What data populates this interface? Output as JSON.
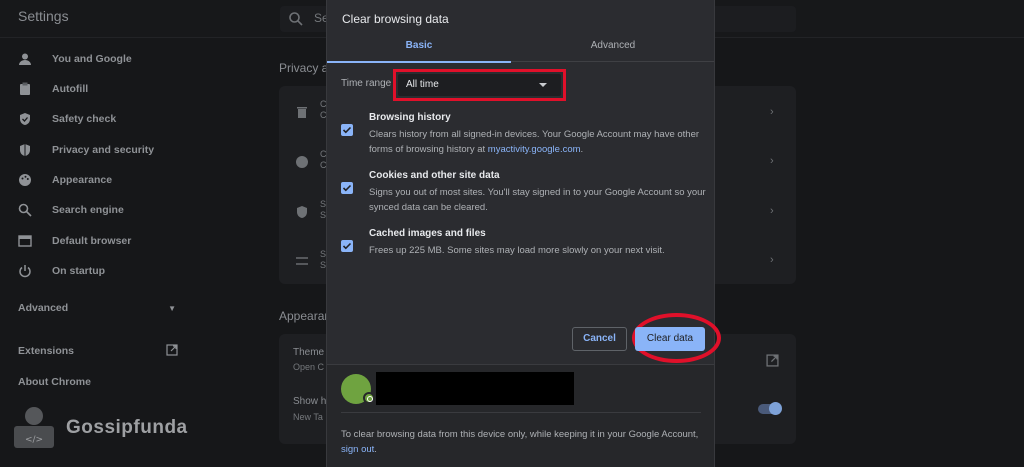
{
  "app": {
    "title": "Settings",
    "search_placeholder": "Se"
  },
  "sidebar": {
    "items": [
      {
        "label": "You and Google",
        "icon": "person-icon"
      },
      {
        "label": "Autofill",
        "icon": "clipboard-icon"
      },
      {
        "label": "Safety check",
        "icon": "shield-check-icon"
      },
      {
        "label": "Privacy and security",
        "icon": "shield-icon"
      },
      {
        "label": "Appearance",
        "icon": "palette-icon"
      },
      {
        "label": "Search engine",
        "icon": "search-icon"
      },
      {
        "label": "Default browser",
        "icon": "browser-icon"
      },
      {
        "label": "On startup",
        "icon": "power-icon"
      }
    ],
    "advanced_label": "Advanced",
    "extensions_label": "Extensions",
    "about_label": "About Chrome"
  },
  "background": {
    "privacy_heading": "Privacy a",
    "appearance_heading": "Appearan",
    "theme_label": "Theme",
    "theme_sub": "Open C",
    "show_label": "Show h",
    "show_sub": "New Ta",
    "row_letters": [
      "C",
      "C",
      "S",
      "S"
    ],
    "row_sub_letters": [
      "C",
      "C",
      "S",
      "S"
    ]
  },
  "watermark": {
    "text": "Gossipfunda"
  },
  "dialog": {
    "title": "Clear browsing data",
    "tabs": {
      "basic": "Basic",
      "advanced": "Advanced"
    },
    "time_range_label": "Time range",
    "time_range_value": "All time",
    "options": [
      {
        "title": "Browsing history",
        "desc": "Clears history from all signed-in devices. Your Google Account may have other forms of browsing history at",
        "link": "myactivity.google.com",
        "desc_end": ".",
        "checked": true
      },
      {
        "title": "Cookies and other site data",
        "desc": "Signs you out of most sites. You'll stay signed in to your Google Account so your synced data can be cleared.",
        "checked": true
      },
      {
        "title": "Cached images and files",
        "desc": "Frees up 225 MB. Some sites may load more slowly on your next visit.",
        "checked": true
      }
    ],
    "cancel_label": "Cancel",
    "clear_label": "Clear data",
    "footer_note": "To clear browsing data from this device only, while keeping it in your Google Account,",
    "footer_link": "sign out",
    "footer_end": "."
  },
  "colors": {
    "accent": "#8ab4f8",
    "highlight": "#e0102a",
    "dialog_bg": "#2b2c30",
    "page_bg": "#161719"
  }
}
